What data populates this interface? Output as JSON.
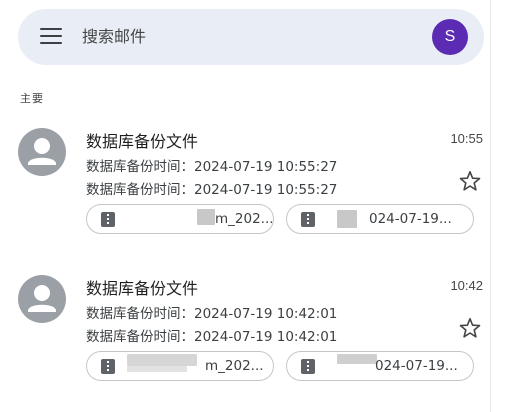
{
  "search": {
    "placeholder": "搜索邮件",
    "avatar_initial": "S"
  },
  "section_label": "主要",
  "colors": {
    "search_bg": "#e9eef6",
    "avatar_user": "#5c2bb4",
    "sender_avatar": "#9aa0a6"
  },
  "icons": [
    "menu-icon",
    "person-avatar-icon",
    "star-outline-icon",
    "zip-file-icon"
  ],
  "messages": [
    {
      "subject": "数据库备份文件",
      "time": "10:55",
      "line1": "数据库备份时间：2024-07-19 10:55:27",
      "line2": "数据库备份时间：2024-07-19 10:55:27",
      "attachments": [
        "m_202...",
        "024-07-19..."
      ]
    },
    {
      "subject": "数据库备份文件",
      "time": "10:42",
      "line1": "数据库备份时间：2024-07-19 10:42:01",
      "line2": "数据库备份时间：2024-07-19 10:42:01",
      "attachments": [
        "m_202...",
        "024-07-19..."
      ]
    }
  ]
}
